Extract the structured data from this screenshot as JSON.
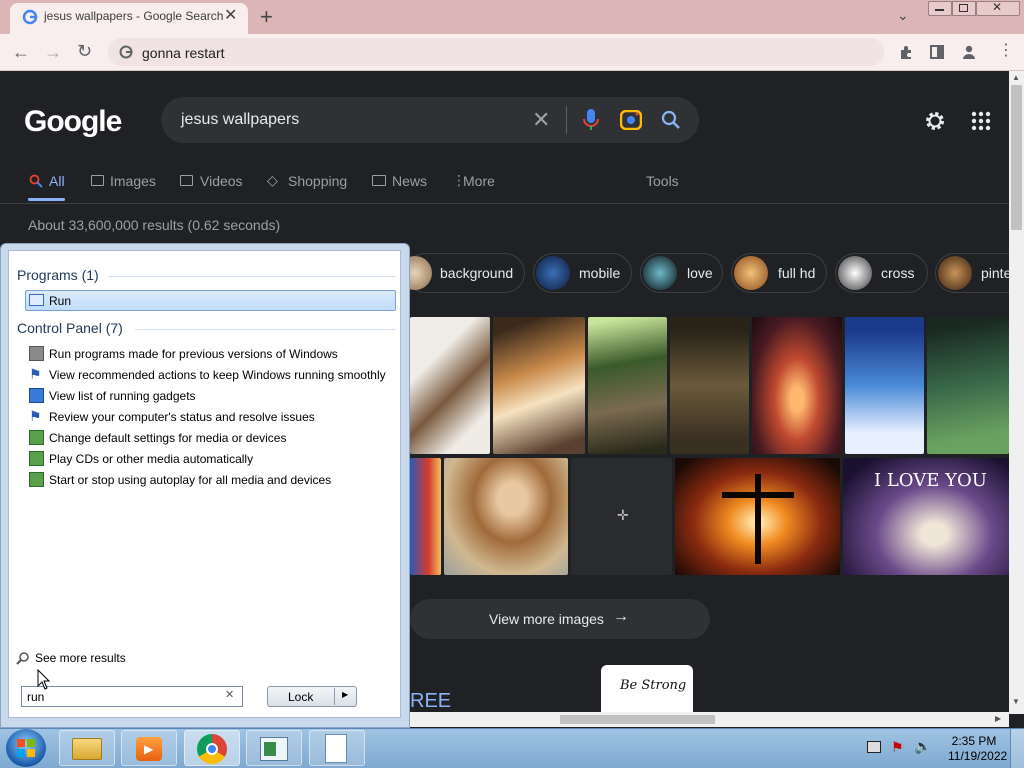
{
  "browser": {
    "tab_title": "jesus wallpapers - Google Search",
    "new_tab": "+",
    "address": "gonna restart"
  },
  "google": {
    "logo": "Google",
    "query": "jesus wallpapers",
    "nav": [
      {
        "label": "All",
        "icon": "search-icon"
      },
      {
        "label": "Images",
        "icon": "image-icon"
      },
      {
        "label": "Videos",
        "icon": "play-icon"
      },
      {
        "label": "Shopping",
        "icon": "tag-icon"
      },
      {
        "label": "News",
        "icon": "news-icon"
      },
      {
        "label": "More",
        "icon": "more-vert-icon"
      }
    ],
    "tools": "Tools",
    "stats": "About 33,600,000 results (0.62 seconds)",
    "chips": [
      "background",
      "mobile",
      "love",
      "full hd",
      "cross",
      "pinte"
    ],
    "view_more": "View more images",
    "partial_text": "REE",
    "card_text": "Be Strong"
  },
  "start_menu": {
    "programs_header": "Programs (1)",
    "run_label": "Run",
    "control_panel_header": "Control Panel (7)",
    "control_panel_items": [
      "Run programs made for previous versions of Windows",
      "View recommended actions to keep Windows running smoothly",
      "View list of running gadgets",
      "Review your computer's status and resolve issues",
      "Change default settings for media or devices",
      "Play CDs or other media automatically",
      "Start or stop using autoplay for all media and devices"
    ],
    "see_more": "See more results",
    "search_value": "run",
    "lock_label": "Lock"
  },
  "taskbar": {
    "time": "2:35 PM",
    "date": "11/19/2022"
  },
  "colors": {
    "accent": "#8ab4f8",
    "page_bg": "#202124",
    "tab_bg": "#dcb6b6"
  }
}
